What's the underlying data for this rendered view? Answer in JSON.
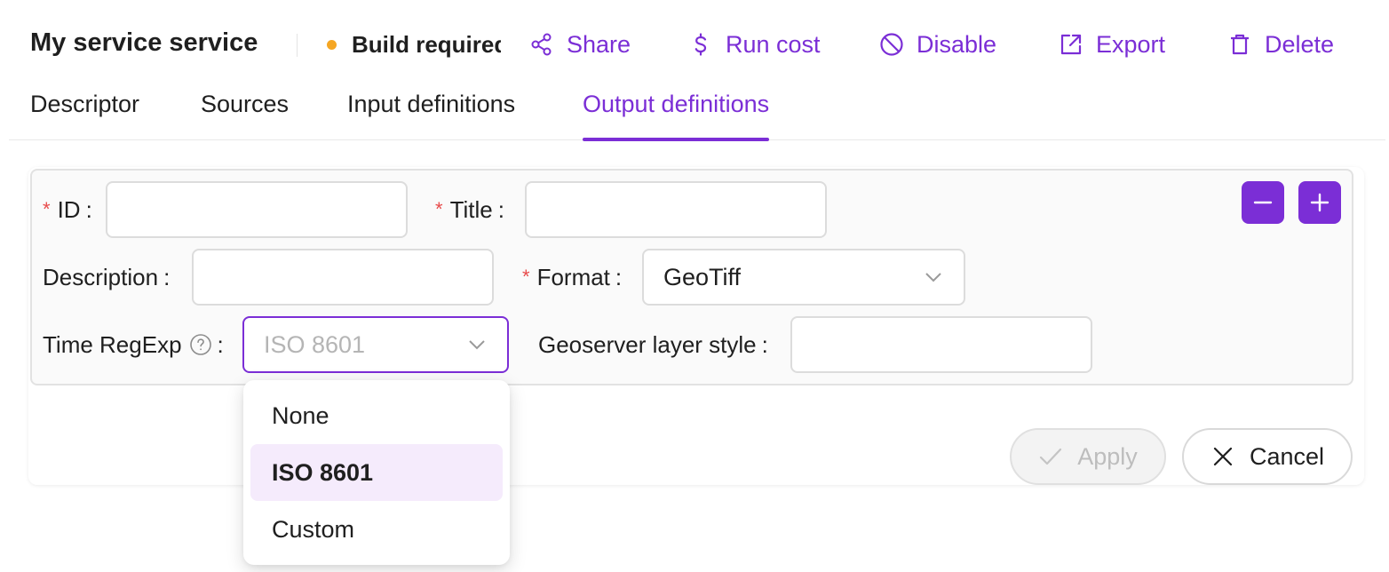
{
  "header": {
    "title": "My service service",
    "status": {
      "label": "Build required",
      "color": "#f5a623"
    },
    "actions": [
      {
        "label": "Share",
        "icon": "share-icon"
      },
      {
        "label": "Run cost",
        "icon": "dollar-icon"
      },
      {
        "label": "Disable",
        "icon": "disable-icon"
      },
      {
        "label": "Export",
        "icon": "export-icon"
      },
      {
        "label": "Delete",
        "icon": "trash-icon"
      }
    ]
  },
  "tabs": [
    {
      "label": "Descriptor",
      "active": false
    },
    {
      "label": "Sources",
      "active": false
    },
    {
      "label": "Input definitions",
      "active": false
    },
    {
      "label": "Output definitions",
      "active": true
    }
  ],
  "form": {
    "id": {
      "label": "ID",
      "required": true,
      "value": ""
    },
    "title": {
      "label": "Title",
      "required": true,
      "value": ""
    },
    "description": {
      "label": "Description",
      "required": false,
      "value": ""
    },
    "format": {
      "label": "Format",
      "required": true,
      "value": "GeoTiff"
    },
    "time_regexp": {
      "label": "Time RegExp",
      "required": false,
      "value": "ISO 8601",
      "help_icon": "question-circle-icon"
    },
    "geoserver_style": {
      "label": "Geoserver layer style",
      "required": false,
      "value": ""
    },
    "remove_icon": "minus-icon",
    "add_icon": "plus-icon"
  },
  "footer": {
    "apply_label": "Apply",
    "cancel_label": "Cancel"
  },
  "dropdown": {
    "options": [
      "None",
      "ISO 8601",
      "Custom"
    ],
    "selected": "ISO 8601"
  },
  "colors": {
    "accent": "#7b2ed6",
    "required": "#e84a4a",
    "selected_option_bg": "#f5ebfc"
  }
}
